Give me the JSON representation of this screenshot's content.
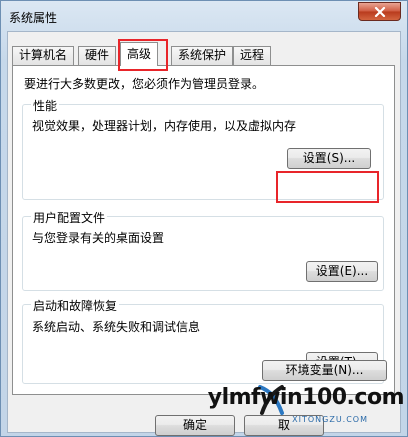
{
  "window": {
    "title": "系统属性"
  },
  "tabs": [
    {
      "label": "计算机名"
    },
    {
      "label": "硬件"
    },
    {
      "label": "高级"
    },
    {
      "label": "系统保护"
    },
    {
      "label": "远程"
    }
  ],
  "admin_note": "要进行大多数更改，您必须作为管理员登录。",
  "performance": {
    "title": "性能",
    "description": "视觉效果，处理器计划，内存使用，以及虚拟内存",
    "button": "设置(S)..."
  },
  "user_profiles": {
    "title": "用户配置文件",
    "description": "与您登录有关的桌面设置",
    "button": "设置(E)..."
  },
  "startup_recovery": {
    "title": "启动和故障恢复",
    "description": "系统启动、系统失败和调试信息",
    "button": "设置(T)..."
  },
  "env_button": "环境变量(N)...",
  "footer": {
    "ok": "确定",
    "cancel": "取"
  },
  "watermark": {
    "main": "ylmfwin100.com",
    "sub": "XITONGZU.COM"
  },
  "colors": {
    "highlight": "#e8252a",
    "close_button": "#c9452a"
  }
}
